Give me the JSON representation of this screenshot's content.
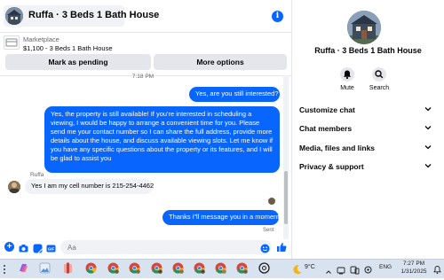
{
  "header": {
    "title": "Ruffa · 3 Beds 1 Bath House"
  },
  "listing": {
    "source": "Marketplace",
    "summary": "$1,100 - 3 Beds 1 Bath House",
    "mark_pending_label": "Mark as pending",
    "more_options_label": "More options"
  },
  "conversation": {
    "timestamp": "7:18 PM",
    "messages": [
      {
        "text": "Yes, are you still interested?"
      },
      {
        "text": "Yes, the property is still available! If you're interested in scheduling a viewing, I would be happy to arrange a convenient time for you. Please send me your contact number so I can share the full address, provide more details about the house, and discuss available viewing slots. Let me know if you have any specific questions about the property or its features, and I will be glad to assist you"
      },
      {
        "sender": "Ruffa",
        "text": "Yes I am my cell number is 215-254-4462"
      },
      {
        "text": "Thanks i\"ll message you in a moment"
      }
    ],
    "status": "Sent"
  },
  "composer": {
    "placeholder": "Aa"
  },
  "info_panel": {
    "name": "Ruffa · 3 Beds 1 Bath House",
    "actions": {
      "mute": "Mute",
      "search": "Search"
    },
    "sections": [
      "Customize chat",
      "Chat members",
      "Media, files and links",
      "Privacy & support"
    ]
  },
  "taskbar": {
    "weather": "9°C",
    "language": "ENG",
    "time": "7:27 PM",
    "date": "1/31/2025"
  },
  "colors": {
    "accent": "#0866ff",
    "bubble_in": "#f0f2f5"
  }
}
